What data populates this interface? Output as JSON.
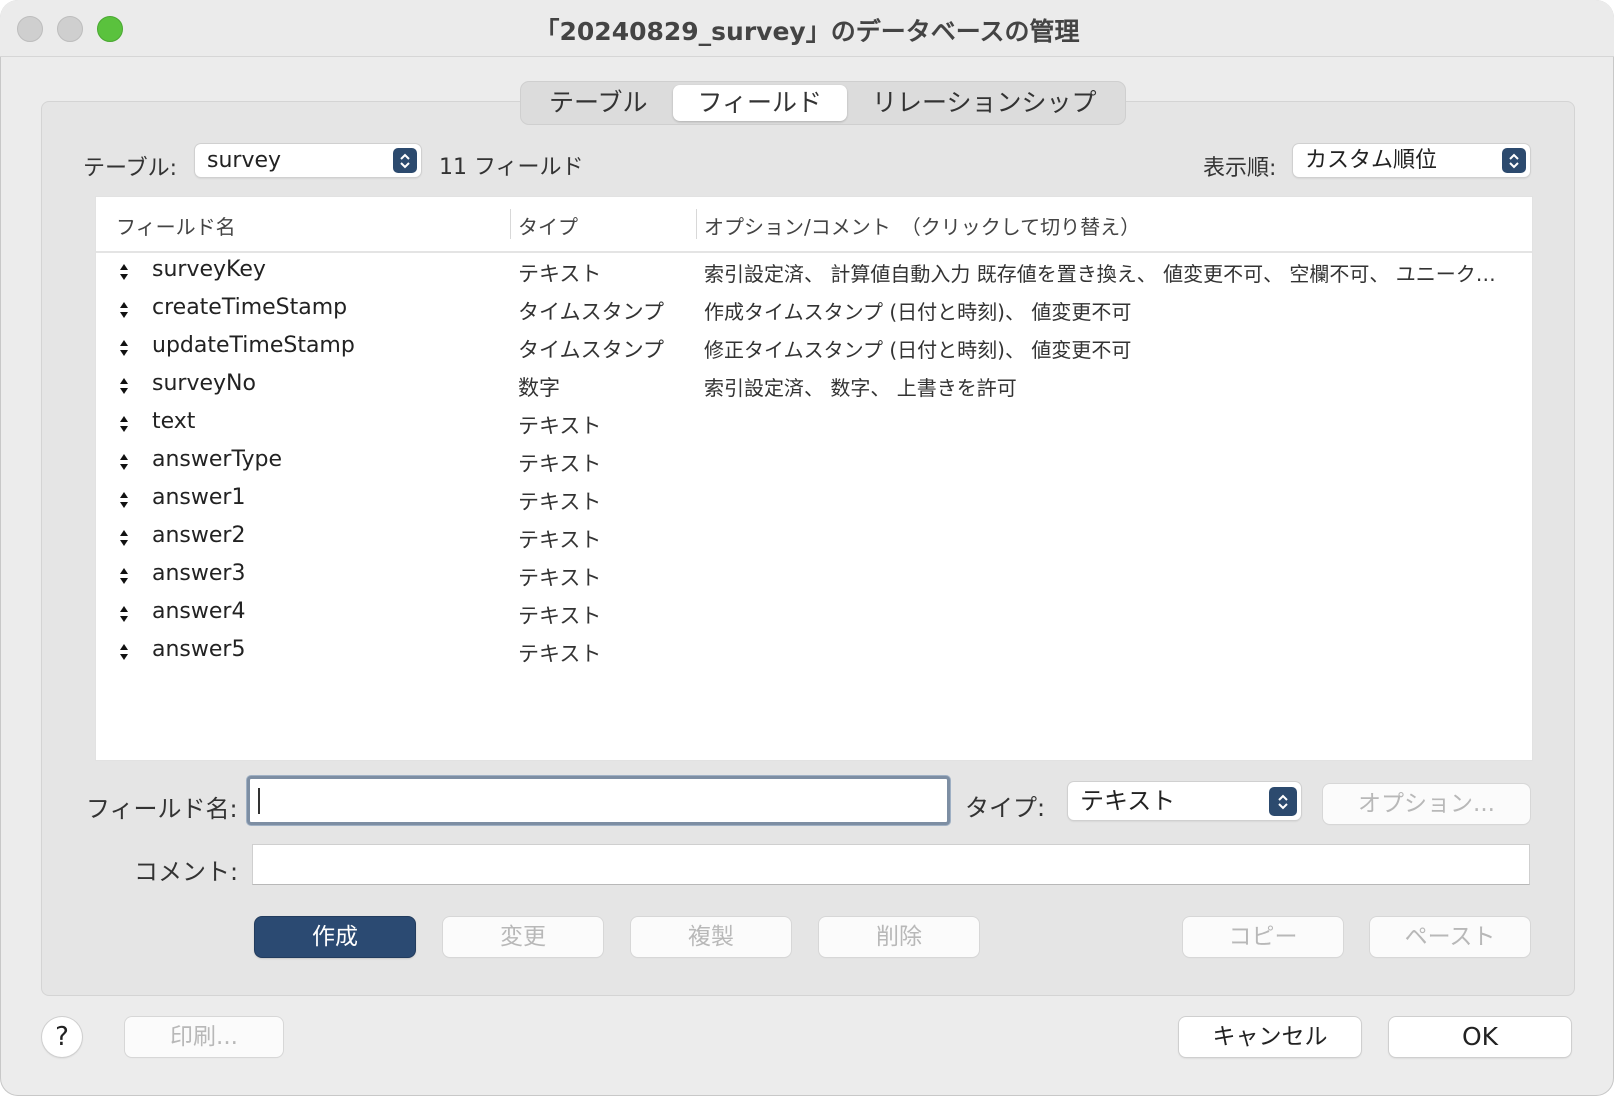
{
  "window": {
    "title": "「20240829_survey」のデータベースの管理"
  },
  "tabs": [
    {
      "label": "テーブル",
      "active": false
    },
    {
      "label": "フィールド",
      "active": true
    },
    {
      "label": "リレーションシップ",
      "active": false
    }
  ],
  "toolbar": {
    "table_label": "テーブル:",
    "table_value": "survey",
    "field_count": "11 フィールド",
    "sort_label": "表示順:",
    "sort_value": "カスタム順位"
  },
  "table": {
    "columns": [
      "フィールド名",
      "タイプ",
      "オプション/コメント　（クリックして切り替え）"
    ],
    "rows": [
      {
        "name": "surveyKey",
        "type": "テキスト",
        "options": "索引設定済、 計算値自動入力 既存値を置き換え、 値変更不可、 空欄不可、 ユニーク…"
      },
      {
        "name": "createTimeStamp",
        "type": "タイムスタンプ",
        "options": "作成タイムスタンプ (日付と時刻)、 値変更不可"
      },
      {
        "name": "updateTimeStamp",
        "type": "タイムスタンプ",
        "options": "修正タイムスタンプ (日付と時刻)、 値変更不可"
      },
      {
        "name": "surveyNo",
        "type": "数字",
        "options": "索引設定済、 数字、 上書きを許可"
      },
      {
        "name": "text",
        "type": "テキスト",
        "options": ""
      },
      {
        "name": "answerType",
        "type": "テキスト",
        "options": ""
      },
      {
        "name": "answer1",
        "type": "テキスト",
        "options": ""
      },
      {
        "name": "answer2",
        "type": "テキスト",
        "options": ""
      },
      {
        "name": "answer3",
        "type": "テキスト",
        "options": ""
      },
      {
        "name": "answer4",
        "type": "テキスト",
        "options": ""
      },
      {
        "name": "answer5",
        "type": "テキスト",
        "options": ""
      }
    ]
  },
  "form": {
    "field_name_label": "フィールド名:",
    "field_name_value": "",
    "type_label": "タイプ:",
    "type_value": "テキスト",
    "options_button": "オプション...",
    "comment_label": "コメント:",
    "comment_value": ""
  },
  "actions": {
    "create": "作成",
    "change": "変更",
    "duplicate": "複製",
    "delete": "削除",
    "copy": "コピー",
    "paste": "ペースト"
  },
  "footer": {
    "help": "?",
    "print": "印刷...",
    "cancel": "キャンセル",
    "ok": "OK"
  },
  "colors": {
    "accent": "#2b4a72",
    "close_light": "#cfcfcf",
    "zoom_light": "#5ac23d"
  }
}
